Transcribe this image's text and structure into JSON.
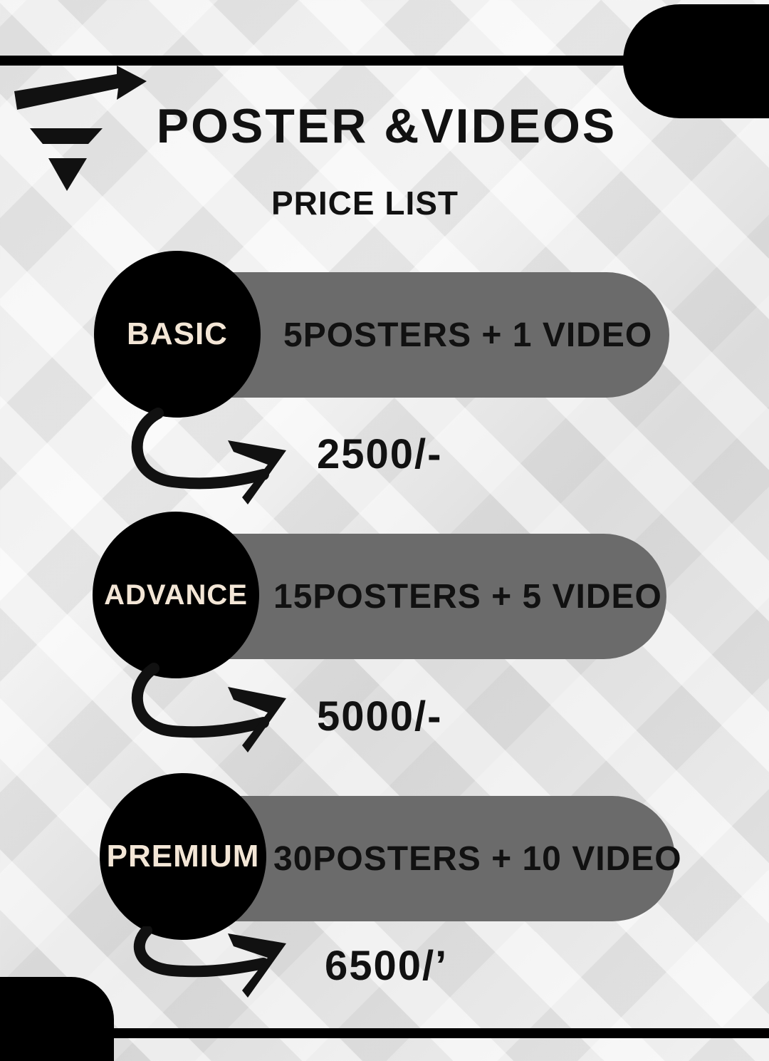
{
  "header": {
    "title": "POSTER &VIDEOS",
    "subtitle": "PRICE LIST"
  },
  "plans": [
    {
      "name": "BASIC",
      "offer": "5POSTERS + 1 VIDEO",
      "price": "2500/-"
    },
    {
      "name": "ADVANCE",
      "offer": "15POSTERS + 5 VIDEO",
      "price": "5000/-"
    },
    {
      "name": "PREMIUM",
      "offer": "30POSTERS + 10 VIDEO",
      "price": "6500/’"
    }
  ],
  "colors": {
    "black": "#000000",
    "pill_gray": "#6b6b6b",
    "badge_text": "#f3e6d6"
  }
}
